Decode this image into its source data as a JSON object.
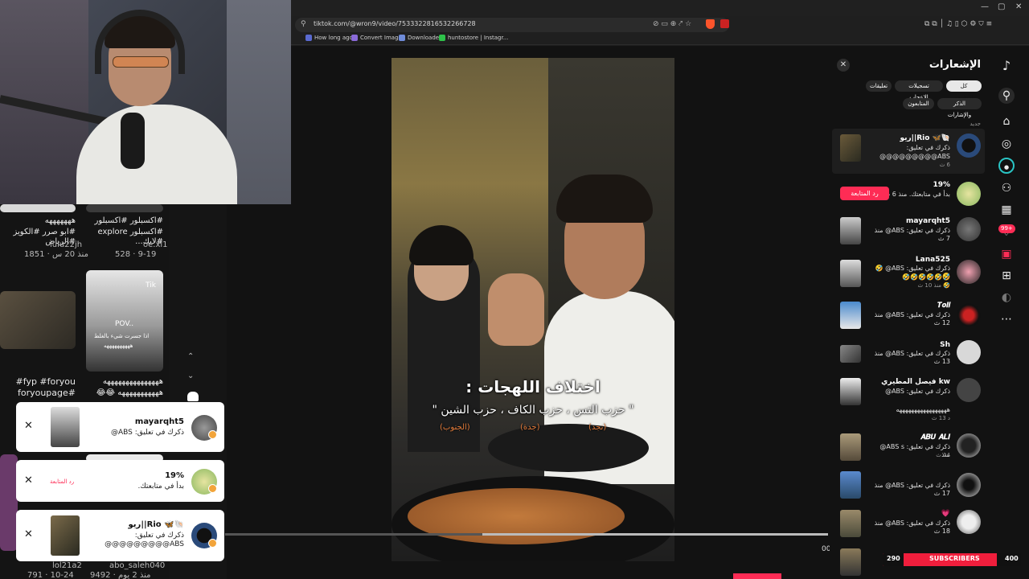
{
  "browser": {
    "url": "tiktok.com/@wron9/video/7533322816532266728",
    "bookmarks": [
      "How long ago",
      "Convert Image",
      "Downloader",
      "huntostore | Instagr..."
    ],
    "window_controls": [
      "—",
      "▢",
      "✕"
    ]
  },
  "left_grid": {
    "cap1_line1": "#اكسبلور #اكسبلور",
    "cap1_line2": "#اكسبلور explore #لايك...",
    "user1": "oe.xl1",
    "meta1": "528 · 9-19",
    "cap2_line1": "هههههههه",
    "cap2_line2": "#ابو صرر #الكويز #الرياض",
    "user2": "lulu22jh",
    "meta2": "1851 · منذ 20 س",
    "thumb_text1": "Tik",
    "thumb_text2": "POV..",
    "thumb_text3": "اذا جسرت شيء بالغلط",
    "thumb_text4": "ههههههههههه",
    "cap3": "fyp #foryou#",
    "cap4": "#foryoupage",
    "cap5": "هههههههههههههههه",
    "cap6": "هههههههههههه 😂😂",
    "user3": "lol21a2",
    "meta3": "791 · 10-24",
    "user4": "abo_saleh040",
    "meta4": "9492 · منذ 2 يوم"
  },
  "video": {
    "title": "اختلاف اللهجات :",
    "subtitle": "\" حزب التس ، حزب الكاف ، حزب الشين \"",
    "tag1": "(نجد)",
    "tag2": "(جدة)",
    "tag3": "(الجنوب)",
    "time": "00"
  },
  "notifications": {
    "title": "الإشعارات",
    "close": "✕",
    "chips": [
      "كل الأنشطة",
      "تسجيلات الإعجاب",
      "تعليقات",
      "الذكر والإشارات",
      "المتابعون"
    ],
    "section": "جديد",
    "follow_label": "رد المتابعة",
    "items": [
      {
        "name": "ريو||Rio 🦋🐚",
        "text": "ذكرك في تعليق:",
        "text2": "ABS@@@@@@@@@",
        "time": "6 ث"
      },
      {
        "name": "19%",
        "text": "بدأ في متابعتك. منذ 6 ث",
        "time": ""
      },
      {
        "name": "mayarqht5",
        "text": "ذكرك في تعليق: ABS@ منذ 7 ث",
        "time": ""
      },
      {
        "name": "Lana525",
        "text": "ذكرك في تعليق: ABS@ 🤣🤣",
        "text2": "🤣🤣🤣🤣🤣🤣",
        "time": "🤣 منذ 10 ث"
      },
      {
        "name": "𝑻𝒐𝒍𝒍",
        "text": "ذكرك في تعليق: ABS@ منذ 12 ث",
        "time": ""
      },
      {
        "name": "Sh",
        "text": "ذكرك في تعليق: ABS@ منذ 13 ث",
        "time": ""
      },
      {
        "name": "فيصل المطيري kw",
        "text": "ذكرك في تعليق: ABS@",
        "text2": "هههههههههههههههههه",
        "time": "د 13 ث"
      },
      {
        "name": "𝑨𝑩𝑼 𝑨𝑳𝑰",
        "text": "ذكرك في تعليق: ABS s@ منذ",
        "time": "14 ث"
      },
      {
        "name": "",
        "text": "ذكرك في تعليق: ABS@ منذ 17 ث",
        "time": ""
      },
      {
        "name": "💗",
        "text": "ذكرك في تعليق: ABS@ منذ 18 ث",
        "time": ""
      }
    ]
  },
  "strip_icons": [
    "tiktok-logo",
    "search",
    "home",
    "explore",
    "live",
    "following",
    "inbox",
    "activity",
    "messages",
    "upload",
    "profile",
    "more"
  ],
  "strip_badge": "99+",
  "toasts": [
    {
      "name": "mayarqht5",
      "text": "ذكرك في تعليق: ABS@"
    },
    {
      "name": "19%",
      "text": "بدأ في متابعتك.",
      "follow": "رد المتابعة"
    },
    {
      "name": "ريو||Rio 🦋🐚",
      "text": "ذكرك في تعليق:",
      "text2": "ABS@@@@@@@@@"
    }
  ],
  "subscribers": {
    "left": "290",
    "label": "SUBSCRIBERS",
    "right": "400"
  },
  "colors": {
    "brand_pink": "#fe2c55",
    "subs_red": "#f01e3c",
    "panel_bg": "#121212"
  }
}
